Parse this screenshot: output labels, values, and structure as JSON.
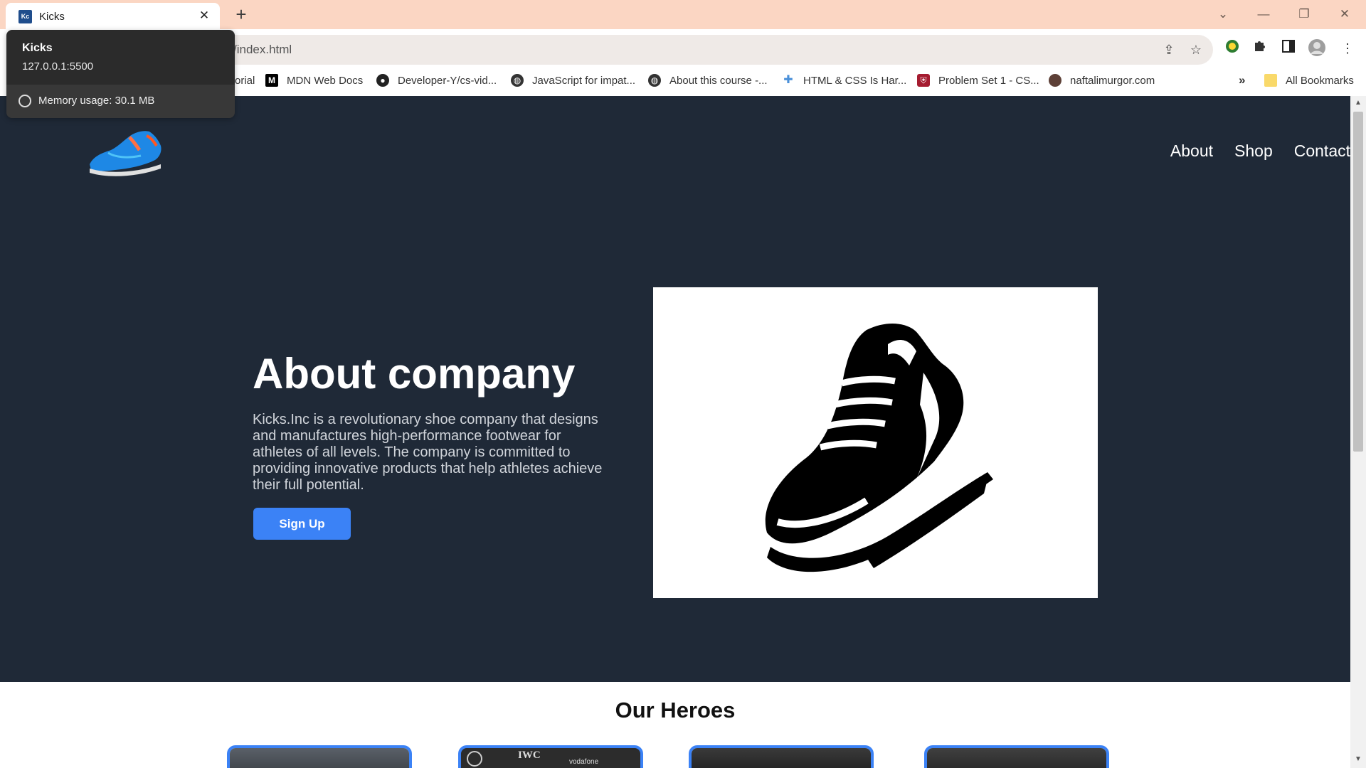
{
  "browser": {
    "tab_title": "Kicks",
    "tab_close": "✕",
    "new_tab": "+",
    "url_text": "/index.html",
    "window_controls": [
      "⌄",
      "—",
      "❐",
      "✕"
    ]
  },
  "hovercard": {
    "title": "Kicks",
    "url": "127.0.0.1:5500",
    "memory": "Memory usage: 30.1 MB"
  },
  "bookmarks": {
    "items": [
      {
        "label": "orial"
      },
      {
        "label": "MDN Web Docs"
      },
      {
        "label": "Developer-Y/cs-vid..."
      },
      {
        "label": "JavaScript for impat..."
      },
      {
        "label": "About this course -..."
      },
      {
        "label": "HTML & CSS Is Har..."
      },
      {
        "label": "Problem Set 1 - CS..."
      },
      {
        "label": "naftalimurgor.com"
      }
    ],
    "overflow": "»",
    "all_bookmarks": "All Bookmarks"
  },
  "page": {
    "nav": [
      "About",
      "Shop",
      "Contact"
    ],
    "hero_title": "About company",
    "hero_text": "Kicks.Inc is a revolutionary shoe company that designs and manufactures high-performance footwear for athletes of all levels. The company is committed to providing innovative products that help athletes achieve their full potential.",
    "signup_label": "Sign Up",
    "heroes_title": "Our Heroes",
    "card_texts": [
      "IWC",
      "vodafone"
    ]
  },
  "colors": {
    "hero_bg": "#1f2937",
    "accent": "#3b82f6",
    "tabstrip": "#fbd6c3"
  }
}
